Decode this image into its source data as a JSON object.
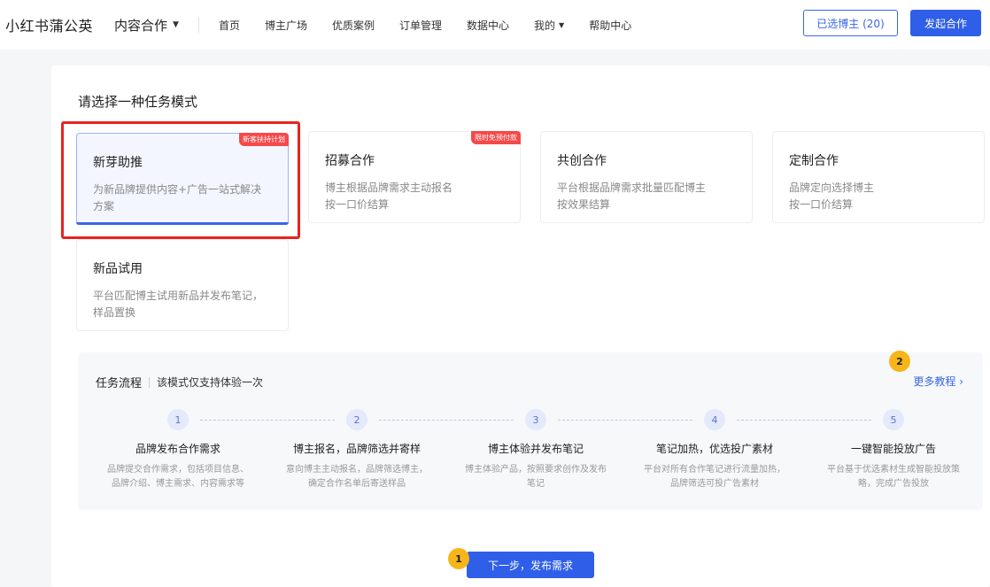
{
  "header": {
    "brand": "小红书蒲公英",
    "product": "内容合作",
    "nav": [
      "首页",
      "博主广场",
      "优质案例",
      "订单管理",
      "数据中心",
      "我的",
      "帮助中心"
    ],
    "selected_bloggers": "已选博主 (20)",
    "start_button": "发起合作"
  },
  "main": {
    "section_title": "请选择一种任务模式",
    "cards": [
      {
        "title": "新芽助推",
        "desc": "为新品牌提供内容+广告一站式解决方案",
        "tag": "新客扶持计划"
      },
      {
        "title": "招募合作",
        "desc_lines": [
          "博主根据品牌需求主动报名",
          "按一口价结算"
        ],
        "tag": "限时免预付款"
      },
      {
        "title": "共创合作",
        "desc_lines": [
          "平台根据品牌需求批量匹配博主",
          "按效果结算"
        ]
      },
      {
        "title": "定制合作",
        "desc_lines": [
          "品牌定向选择博主",
          "按一口价结算"
        ]
      },
      {
        "title": "新品试用",
        "desc": "平台匹配博主试用新品并发布笔记，样品置换"
      }
    ],
    "flow": {
      "title": "任务流程",
      "subtitle": "该模式仅支持体验一次",
      "more": "更多教程 ›",
      "steps": [
        {
          "num": "1",
          "title": "品牌发布合作需求",
          "desc": [
            "品牌提交合作需求，包括项目信息、",
            "品牌介绍、博主需求、内容需求等"
          ]
        },
        {
          "num": "2",
          "title": "博主报名，品牌筛选并寄样",
          "desc": [
            "意向博主主动报名，品牌筛选博主，",
            "确定合作名单后寄送样品"
          ]
        },
        {
          "num": "3",
          "title": "博主体验并发布笔记",
          "desc": [
            "博主体验产品，按照要求创作及发布",
            "笔记"
          ]
        },
        {
          "num": "4",
          "title": "笔记加热，优选投广素材",
          "desc": [
            "平台对所有合作笔记进行流量加热，",
            "品牌筛选可投广告素材"
          ]
        },
        {
          "num": "5",
          "title": "一键智能投放广告",
          "desc": [
            "平台基于优选素材生成智能投放策",
            "略，完成广告投放"
          ]
        }
      ]
    },
    "next_button": "下一步，发布需求",
    "annotations": {
      "badge1": "1",
      "badge2": "2"
    }
  },
  "colors": {
    "primary": "#2f5ee8",
    "tag": "#f5494a",
    "highlight": "#e8231f",
    "badge": "#f6b619"
  }
}
